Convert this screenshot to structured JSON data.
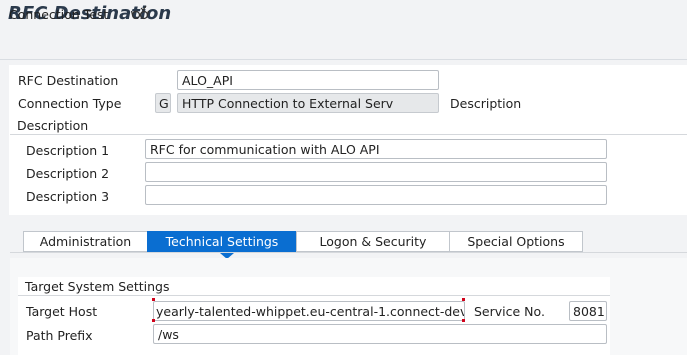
{
  "title": "RFC Destination",
  "toolbar": {
    "connection_test": "Connection Test",
    "icon": "glasses-icon"
  },
  "header": {
    "rfc_destination_label": "RFC Destination",
    "rfc_destination_value": "ALO_API",
    "connection_type_label": "Connection Type",
    "connection_type_code": "G",
    "connection_type_text": "HTTP Connection to External Serv",
    "description_label": "Description"
  },
  "description_section": {
    "title": "Description",
    "rows": [
      {
        "label": "Description 1",
        "value": "RFC for communication with ALO API"
      },
      {
        "label": "Description 2",
        "value": ""
      },
      {
        "label": "Description 3",
        "value": ""
      }
    ]
  },
  "tabs": [
    {
      "label": "Administration",
      "active": false
    },
    {
      "label": "Technical Settings",
      "active": true
    },
    {
      "label": "Logon & Security",
      "active": false
    },
    {
      "label": "Special Options",
      "active": false
    }
  ],
  "target_system": {
    "title": "Target System Settings",
    "target_host_label": "Target Host",
    "target_host_value": "yearly-talented-whippet.eu-central-1.connect-dev",
    "service_no_label": "Service No.",
    "service_no_value": "8081",
    "path_prefix_label": "Path Prefix",
    "path_prefix_value": "/ws"
  },
  "colors": {
    "accent": "#0a6ed1",
    "title": "#2b3a4c",
    "focus_marker": "#d0021b"
  }
}
